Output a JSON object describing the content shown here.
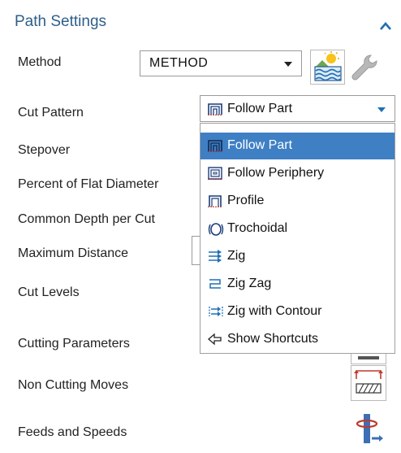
{
  "panel": {
    "title": "Path Settings",
    "collapse_icon": "chevron-up-icon"
  },
  "method": {
    "label": "Method",
    "value": "METHOD",
    "icon_new": "method-new-icon",
    "icon_edit": "wrench-icon"
  },
  "cut_pattern": {
    "label": "Cut Pattern",
    "selected": "Follow Part",
    "options": [
      {
        "label": "Follow Part",
        "icon": "follow-part-icon",
        "selected": true
      },
      {
        "label": "Follow Periphery",
        "icon": "follow-periphery-icon",
        "selected": false
      },
      {
        "label": "Profile",
        "icon": "profile-icon",
        "selected": false
      },
      {
        "label": "Trochoidal",
        "icon": "trochoidal-icon",
        "selected": false
      },
      {
        "label": "Zig",
        "icon": "zig-icon",
        "selected": false
      },
      {
        "label": "Zig Zag",
        "icon": "zig-zag-icon",
        "selected": false
      },
      {
        "label": "Zig with Contour",
        "icon": "zig-with-contour-icon",
        "selected": false
      },
      {
        "label": "Show Shortcuts",
        "icon": "show-shortcuts-icon",
        "selected": false
      }
    ]
  },
  "rows": {
    "stepover": "Stepover",
    "percent_flat": "Percent of Flat Diameter",
    "common_depth": "Common Depth per Cut",
    "max_distance": "Maximum Distance",
    "cut_levels": "Cut Levels",
    "cutting_params": "Cutting Parameters",
    "non_cutting": "Non Cutting Moves",
    "feeds_speeds": "Feeds and Speeds"
  },
  "colors": {
    "title": "#2e5f8a",
    "selection": "#3f7fc4",
    "accent_blue": "#1f6fb5"
  }
}
